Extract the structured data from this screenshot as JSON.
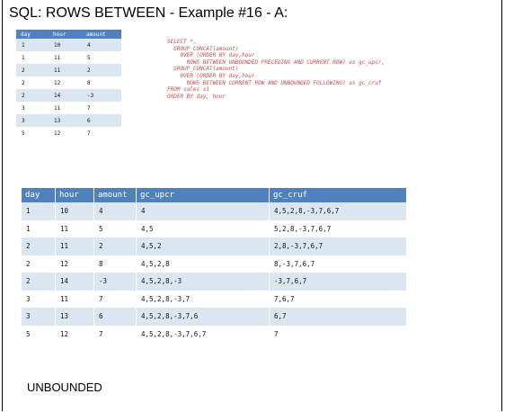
{
  "title": "SQL: ROWS BETWEEN - Example #16 - A:",
  "sales_table": {
    "headers": [
      "day",
      "hour",
      "amount"
    ],
    "rows": [
      [
        "1",
        "10",
        "4"
      ],
      [
        "1",
        "11",
        "5"
      ],
      [
        "2",
        "11",
        "2"
      ],
      [
        "2",
        "12",
        "8"
      ],
      [
        "2",
        "14",
        "-3"
      ],
      [
        "3",
        "11",
        "7"
      ],
      [
        "3",
        "13",
        "6"
      ],
      [
        "5",
        "12",
        "7"
      ]
    ]
  },
  "sql_query": "SELECT *,\n  GROUP_CONCAT(amount)\n    OVER (ORDER BY day,hour\n      ROWS BETWEEN UNBOUNDED PRECEDING AND CURRENT ROW) as gc_upcr,\n  GROUP_CONCAT(amount)\n    OVER (ORDER BY day,hour\n      ROWS BETWEEN CURRENT ROW AND UNBOUNDED FOLLOWING) as gc_cruf\nFROM sales s1\nORDER BY day, hour",
  "result_table": {
    "headers": [
      "day",
      "hour",
      "amount",
      "gc_upcr",
      "gc_cruf"
    ],
    "rows": [
      [
        "1",
        "10",
        "4",
        "4",
        "4,5,2,8,-3,7,6,7"
      ],
      [
        "1",
        "11",
        "5",
        "4,5",
        "5,2,8,-3,7,6,7"
      ],
      [
        "2",
        "11",
        "2",
        "4,5,2",
        "2,8,-3,7,6,7"
      ],
      [
        "2",
        "12",
        "8",
        "4,5,2,8",
        "8,-3,7,6,7"
      ],
      [
        "2",
        "14",
        "-3",
        "4,5,2,8,-3",
        "-3,7,6,7"
      ],
      [
        "3",
        "11",
        "7",
        "4,5,2,8,-3,7",
        "7,6,7"
      ],
      [
        "3",
        "13",
        "6",
        "4,5,2,8,-3,7,6",
        "6,7"
      ],
      [
        "5",
        "12",
        "7",
        "4,5,2,8,-3,7,6,7",
        "7"
      ]
    ]
  },
  "footer_text": "UNBOUNDED",
  "colors": {
    "header_bg": "#4f81bd",
    "band_bg": "#dce6f1",
    "sql_text": "#c0504d"
  }
}
